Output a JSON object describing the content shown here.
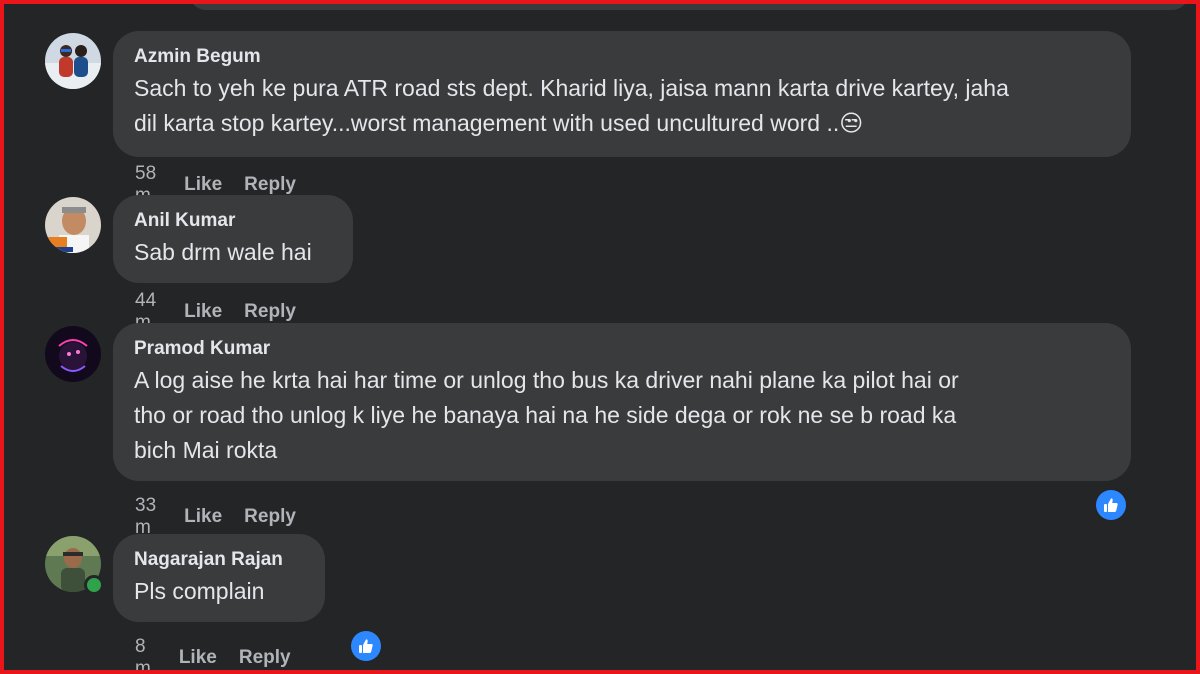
{
  "comments": [
    {
      "author": "Azmin Begum",
      "line1": "Sach to yeh ke pura ATR road sts dept. Kharid liya, jaisa mann karta drive kartey, jaha",
      "line2": "dil karta stop kartey...worst management with used uncultured word ..😒",
      "time": "58 m",
      "like_label": "Like",
      "reply_label": "Reply"
    },
    {
      "author": "Anil Kumar",
      "line1": "Sab drm wale hai",
      "time": "44 m",
      "like_label": "Like",
      "reply_label": "Reply"
    },
    {
      "author": "Pramod Kumar",
      "line1": "A log aise he krta hai har time or unlog tho bus ka driver nahi plane ka pilot hai or",
      "line2": "tho or road tho unlog k liye he banaya hai na he side dega or rok ne se b road ka",
      "line3": "bich Mai rokta",
      "time": "33 m",
      "like_label": "Like",
      "reply_label": "Reply",
      "reaction": "like-icon"
    },
    {
      "author": "Nagarajan Rajan",
      "line1": "Pls complain",
      "time": "8 m",
      "like_label": "Like",
      "reply_label": "Reply",
      "reaction": "like-icon",
      "online": true
    }
  ],
  "colors": {
    "frame_border": "#e8151b",
    "background": "#242526",
    "bubble": "#3a3b3c",
    "text": "#e4e6eb",
    "secondary": "#b0b3b8",
    "like_blue": "#2d88ff",
    "online_green": "#31a24c"
  }
}
